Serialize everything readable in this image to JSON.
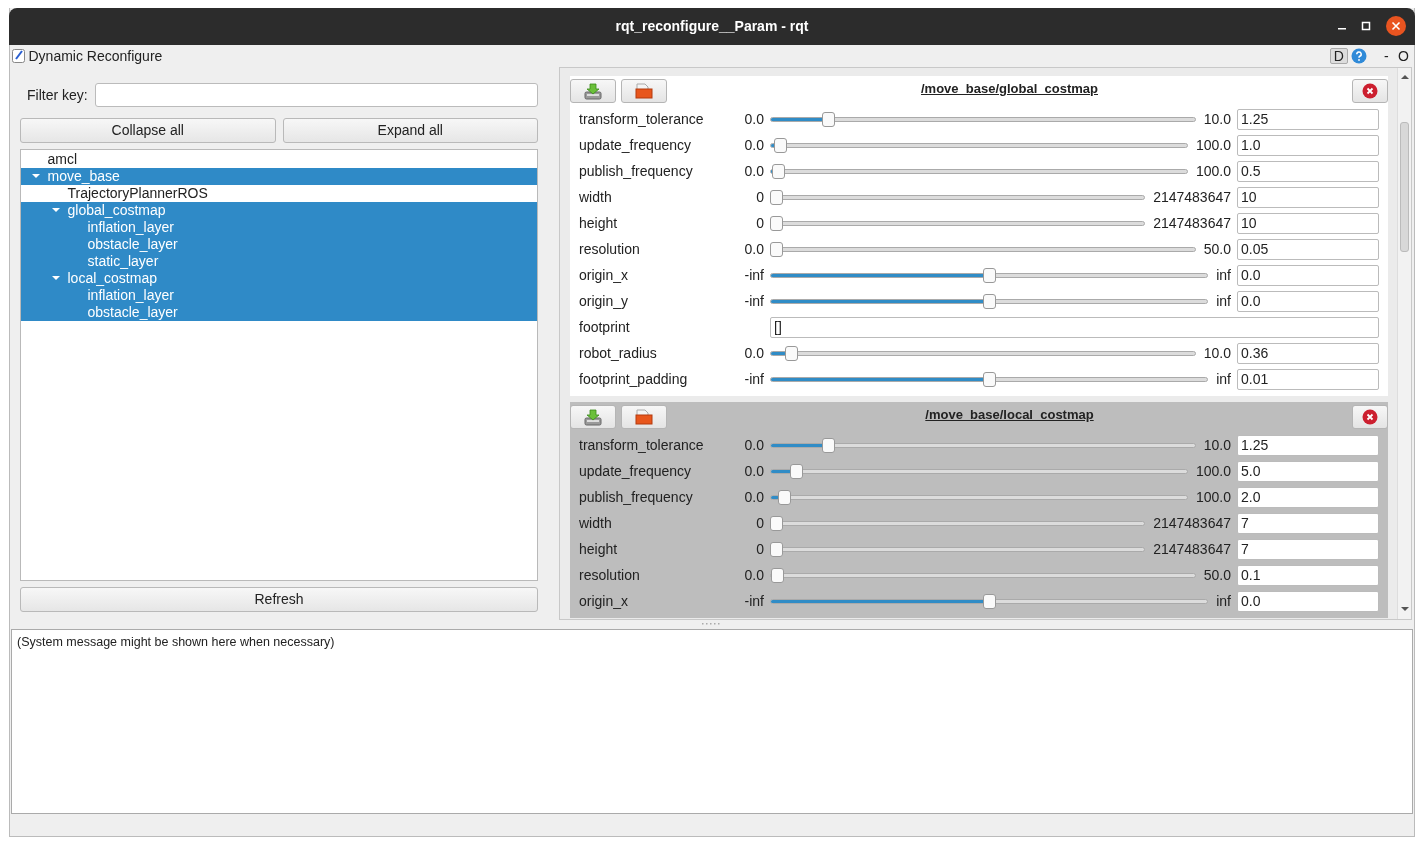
{
  "window": {
    "title": "rqt_reconfigure__Param - rqt"
  },
  "plugin": {
    "title": "Dynamic Reconfigure",
    "header_buttons": [
      "D",
      "-",
      "O"
    ]
  },
  "filter": {
    "label": "Filter key:"
  },
  "tree_buttons": [
    "Collapse all",
    "Expand all"
  ],
  "tree": [
    {
      "label": "amcl",
      "selected": false
    },
    {
      "label": "move_base",
      "selected": true,
      "expanded": true,
      "children": [
        {
          "label": "TrajectoryPlannerROS",
          "selected": false
        },
        {
          "label": "global_costmap",
          "selected": true,
          "expanded": true,
          "children": [
            {
              "label": "inflation_layer",
              "selected": true
            },
            {
              "label": "obstacle_layer",
              "selected": true
            },
            {
              "label": "static_layer",
              "selected": true
            }
          ]
        },
        {
          "label": "local_costmap",
          "selected": true,
          "expanded": true,
          "children": [
            {
              "label": "inflation_layer",
              "selected": true
            },
            {
              "label": "obstacle_layer",
              "selected": true
            }
          ]
        }
      ]
    }
  ],
  "refresh_button": "Refresh",
  "groups": [
    {
      "title": "/move_base/global_costmap",
      "highlighted": false,
      "params": [
        {
          "name": "transform_tolerance",
          "kind": "slider",
          "min": "0.0",
          "max": "10.0",
          "value": "1.25",
          "level": 0.125
        },
        {
          "name": "update_frequency",
          "kind": "slider",
          "min": "0.0",
          "max": "100.0",
          "value": "1.0",
          "level": 0.01
        },
        {
          "name": "publish_frequency",
          "kind": "slider",
          "min": "0.0",
          "max": "100.0",
          "value": "0.5",
          "level": 0.005
        },
        {
          "name": "width",
          "kind": "slider",
          "min": "0",
          "max": "2147483647",
          "value": "10",
          "level": 0.0
        },
        {
          "name": "height",
          "kind": "slider",
          "min": "0",
          "max": "2147483647",
          "value": "10",
          "level": 0.0
        },
        {
          "name": "resolution",
          "kind": "slider",
          "min": "0.0",
          "max": "50.0",
          "value": "0.05",
          "level": 0.001
        },
        {
          "name": "origin_x",
          "kind": "slider",
          "min": "-inf",
          "max": "inf",
          "value": "0.0",
          "level": 0.5
        },
        {
          "name": "origin_y",
          "kind": "slider",
          "min": "-inf",
          "max": "inf",
          "value": "0.0",
          "level": 0.5
        },
        {
          "name": "footprint",
          "kind": "text",
          "value": "[]"
        },
        {
          "name": "robot_radius",
          "kind": "slider",
          "min": "0.0",
          "max": "10.0",
          "value": "0.36",
          "level": 0.036
        },
        {
          "name": "footprint_padding",
          "kind": "slider",
          "min": "-inf",
          "max": "inf",
          "value": "0.01",
          "level": 0.5
        }
      ]
    },
    {
      "title": "/move_base/local_costmap",
      "highlighted": true,
      "params": [
        {
          "name": "transform_tolerance",
          "kind": "slider",
          "min": "0.0",
          "max": "10.0",
          "value": "1.25",
          "level": 0.125
        },
        {
          "name": "update_frequency",
          "kind": "slider",
          "min": "0.0",
          "max": "100.0",
          "value": "5.0",
          "level": 0.05
        },
        {
          "name": "publish_frequency",
          "kind": "slider",
          "min": "0.0",
          "max": "100.0",
          "value": "2.0",
          "level": 0.02
        },
        {
          "name": "width",
          "kind": "slider",
          "min": "0",
          "max": "2147483647",
          "value": "7",
          "level": 0.0
        },
        {
          "name": "height",
          "kind": "slider",
          "min": "0",
          "max": "2147483647",
          "value": "7",
          "level": 0.0
        },
        {
          "name": "resolution",
          "kind": "slider",
          "min": "0.0",
          "max": "50.0",
          "value": "0.1",
          "level": 0.002
        },
        {
          "name": "origin_x",
          "kind": "slider",
          "min": "-inf",
          "max": "inf",
          "value": "0.0",
          "level": 0.5
        }
      ]
    }
  ],
  "message": "(System message might be shown here when necessary)"
}
